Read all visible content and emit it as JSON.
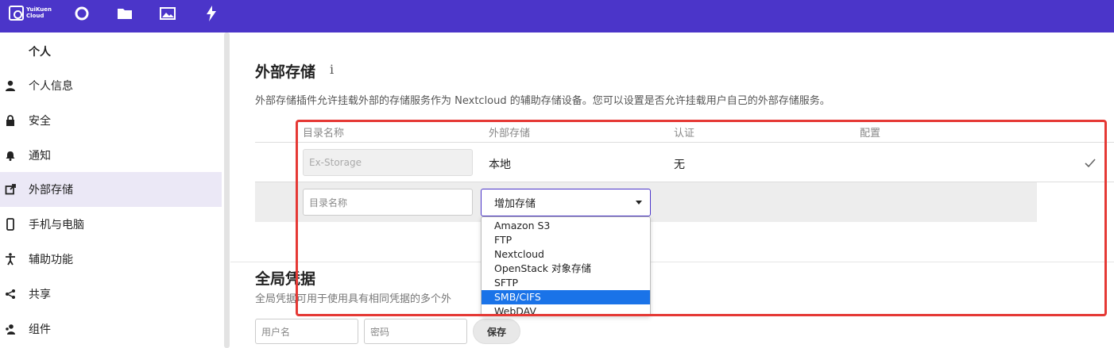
{
  "header": {
    "logo_text": "YuiKuen\nCloud",
    "nav": [
      {
        "icon": "circle-icon"
      },
      {
        "icon": "folder-icon"
      },
      {
        "icon": "image-icon"
      },
      {
        "icon": "lightning-icon"
      }
    ],
    "background": "#4b35c9"
  },
  "sidebar": {
    "section_title": "个人",
    "items": [
      {
        "label": "个人信息",
        "icon": "person-icon"
      },
      {
        "label": "安全",
        "icon": "lock-icon"
      },
      {
        "label": "通知",
        "icon": "bell-icon"
      },
      {
        "label": "外部存储",
        "icon": "external-link-icon",
        "active": true
      },
      {
        "label": "手机与电脑",
        "icon": "phone-icon"
      },
      {
        "label": "辅助功能",
        "icon": "accessibility-icon"
      },
      {
        "label": "共享",
        "icon": "share-icon"
      },
      {
        "label": "组件",
        "icon": "group-icon"
      }
    ],
    "active_color": "#ebe8f6"
  },
  "external_storage": {
    "title": "外部存储",
    "info_icon": "i",
    "description": "外部存储插件允许挂载外部的存储服务作为 Nextcloud 的辅助存储设备。您可以设置是否允许挂载用户自己的外部存储服务。",
    "columns": [
      "目录名称",
      "外部存储",
      "认证",
      "配置"
    ],
    "rows": [
      {
        "folder_name": "Ex-Storage",
        "storage": "本地",
        "auth": "无"
      }
    ],
    "new_row": {
      "folder_placeholder": "目录名称",
      "add_storage_selected": "增加存储",
      "options": [
        "Amazon S3",
        "FTP",
        "Nextcloud",
        "OpenStack 对象存储",
        "SFTP",
        "SMB/CIFS",
        "WebDAV"
      ],
      "highlighted_option": "SMB/CIFS"
    }
  },
  "global_credentials": {
    "title": "全局凭据",
    "description": "全局凭据可用于使用具有相同凭据的多个外",
    "username_placeholder": "用户名",
    "password_placeholder": "密码",
    "save_label": "保存"
  },
  "highlight_color": "#e53935"
}
